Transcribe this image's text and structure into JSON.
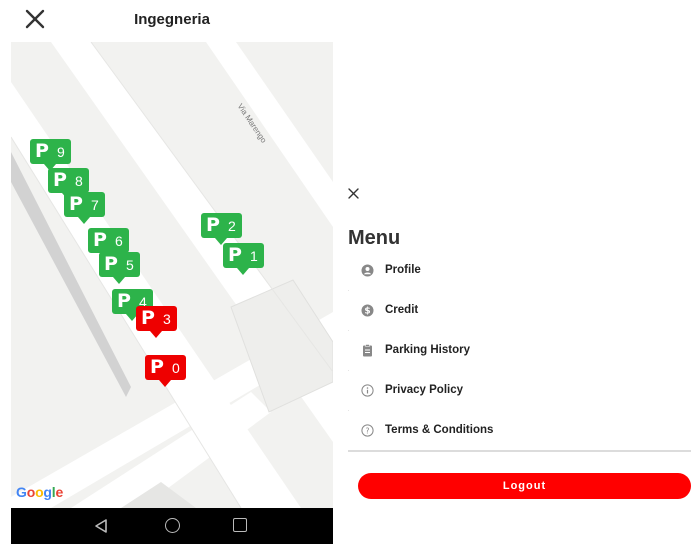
{
  "header": {
    "title": "Ingegneria"
  },
  "map": {
    "street_label": "Via Marengo",
    "attribution": "Google",
    "markers": [
      {
        "label": "P",
        "number": "9",
        "status": "available"
      },
      {
        "label": "P",
        "number": "8",
        "status": "available"
      },
      {
        "label": "P",
        "number": "7",
        "status": "available"
      },
      {
        "label": "P",
        "number": "6",
        "status": "available"
      },
      {
        "label": "P",
        "number": "5",
        "status": "available"
      },
      {
        "label": "P",
        "number": "4",
        "status": "available"
      },
      {
        "label": "P",
        "number": "3",
        "status": "occupied"
      },
      {
        "label": "P",
        "number": "0",
        "status": "occupied"
      },
      {
        "label": "P",
        "number": "2",
        "status": "available"
      },
      {
        "label": "P",
        "number": "1",
        "status": "available"
      }
    ],
    "colors": {
      "available": "#2db34a",
      "occupied": "#ee0000"
    }
  },
  "menu": {
    "title": "Menu",
    "items": [
      {
        "label": "Profile",
        "icon": "user-circle-icon"
      },
      {
        "label": "Credit",
        "icon": "dollar-circle-icon"
      },
      {
        "label": "Parking History",
        "icon": "clipboard-icon"
      },
      {
        "label": "Privacy Policy",
        "icon": "info-circle-icon"
      },
      {
        "label": "Terms & Conditions",
        "icon": "question-circle-icon"
      }
    ],
    "logout_label": "Logout",
    "accent_color": "#ff0000"
  }
}
